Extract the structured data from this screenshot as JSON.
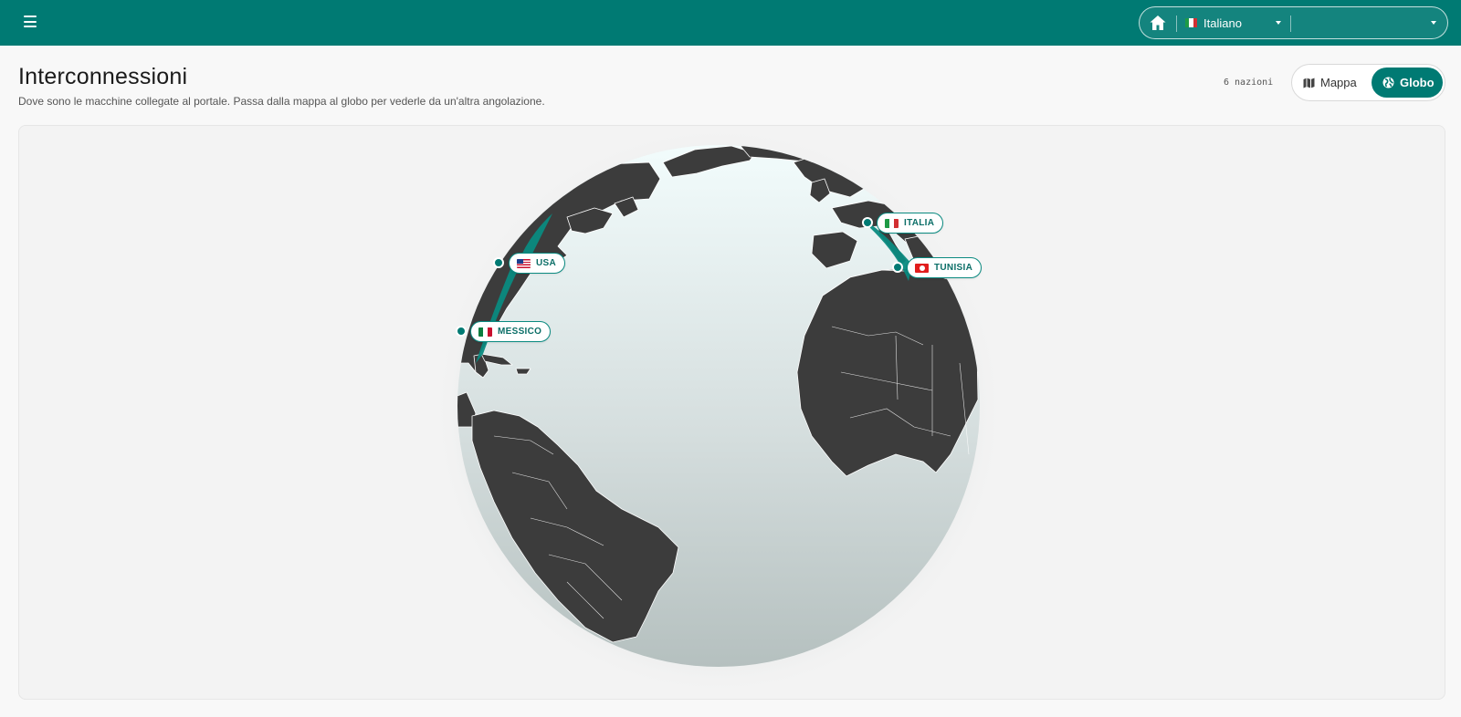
{
  "header": {
    "menu_icon": "menu-icon",
    "home_icon": "home-icon",
    "language": "Italiano",
    "secondary_select_value": ""
  },
  "page": {
    "title": "Interconnessioni",
    "subtitle": "Dove sono le macchine collegate al portale. Passa dalla mappa al globo per vederle da un'altra angolazione."
  },
  "view_toggle": {
    "count_label": "6 nazioni",
    "options": [
      {
        "label": "Mappa",
        "icon": "map-icon",
        "active": false
      },
      {
        "label": "Globo",
        "icon": "globe-icon",
        "active": true
      }
    ]
  },
  "globe": {
    "accent": "#007a73",
    "markers": [
      {
        "label": "ITALIA",
        "flag": "it"
      },
      {
        "label": "TUNISIA",
        "flag": "tn"
      },
      {
        "label": "USA",
        "flag": "us"
      },
      {
        "label": "MESSICO",
        "flag": "mx"
      }
    ]
  }
}
